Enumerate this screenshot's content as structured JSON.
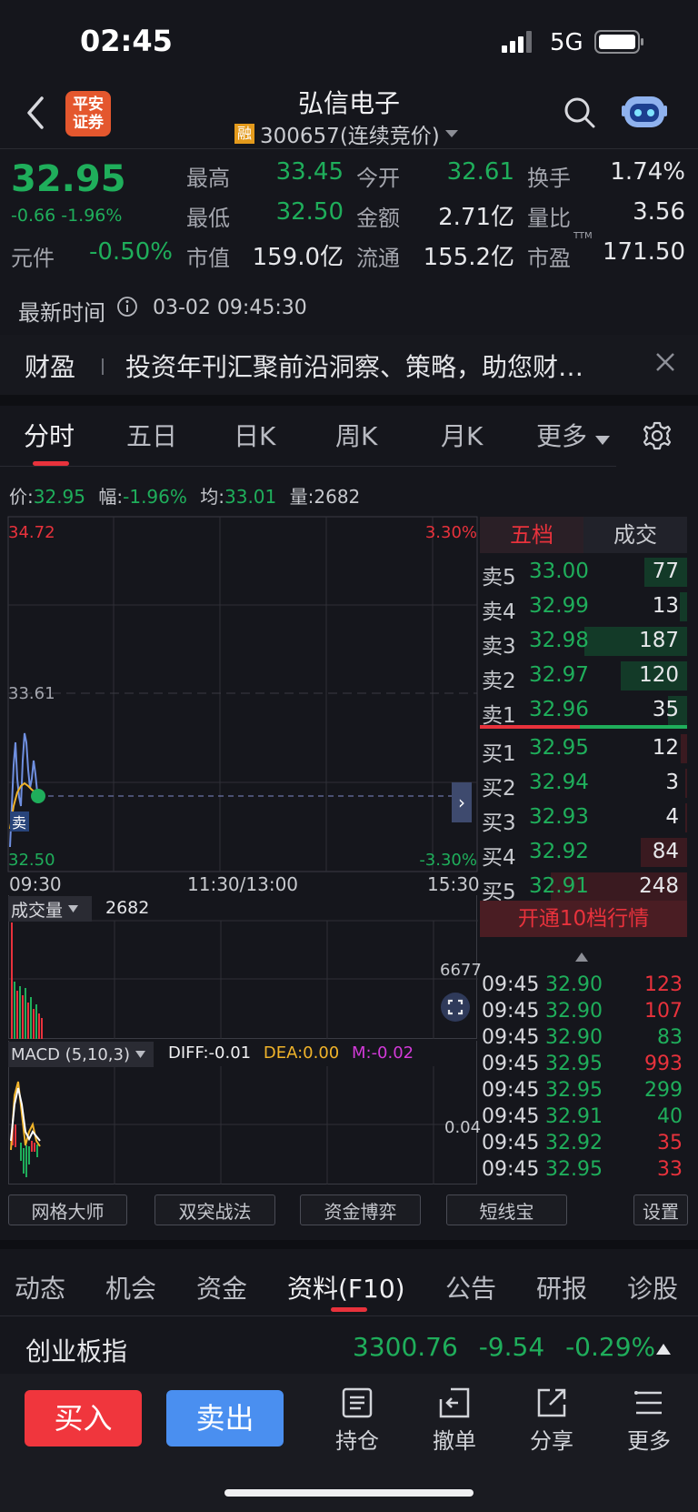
{
  "status_bar": {
    "time": "02:45",
    "network": "5G"
  },
  "header": {
    "badge_line1": "平安",
    "badge_line2": "证券",
    "title": "弘信电子",
    "margin_tag": "融",
    "code": "300657(连续竞价)"
  },
  "quote": {
    "price": "32.95",
    "change": "-0.66",
    "change_pct": "-1.96%",
    "yuanjian_label": "元件",
    "yuanjian_value": "-0.50%",
    "stats": [
      {
        "label": "最高",
        "value": "33.45",
        "color": "green"
      },
      {
        "label": "今开",
        "value": "32.61",
        "color": "green"
      },
      {
        "label": "换手",
        "value": "1.74%",
        "color": "white"
      },
      {
        "label": "最低",
        "value": "32.50",
        "color": "green"
      },
      {
        "label": "金额",
        "value": "2.71亿",
        "color": "white"
      },
      {
        "label": "量比",
        "value": "3.56",
        "color": "white"
      },
      {
        "label": "市值",
        "value": "159.0亿",
        "color": "white"
      },
      {
        "label": "流通",
        "value": "155.2亿",
        "color": "white"
      },
      {
        "label": "市盈",
        "value": "171.50",
        "color": "white"
      }
    ],
    "pe_sup": "TTM",
    "time_label": "最新时间",
    "time_value": "03-02 09:45:30"
  },
  "banner": {
    "brand": "财盈",
    "text": "投资年刊汇聚前沿洞察、策略，助您财…"
  },
  "chart_tabs": [
    "分时",
    "五日",
    "日K",
    "周K",
    "月K",
    "更多"
  ],
  "info_line": {
    "price_label": "价:",
    "price": "32.95",
    "amp_label": "幅:",
    "amp": "-1.96%",
    "avg_label": "均:",
    "avg": "33.01",
    "vol_label": "量:",
    "vol": "2682"
  },
  "chart": {
    "top_price": "34.72",
    "top_pct": "3.30%",
    "mid_price": "33.61",
    "bottom_price": "32.50",
    "bottom_pct": "-3.30%",
    "sell_marker": "卖",
    "x_start": "09:30",
    "x_mid": "11:30/13:00",
    "x_end": "15:30"
  },
  "volume": {
    "label": "成交量",
    "value": "2682",
    "max": "6677"
  },
  "macd": {
    "label": "MACD (5,10,3)",
    "diff": "DIFF:-0.01",
    "dea": "DEA:0.00",
    "m": "M:-0.02",
    "scale": "0.04"
  },
  "orderbook": {
    "tab_active": "五档",
    "tab_other": "成交",
    "asks": [
      {
        "label": "卖5",
        "price": "33.00",
        "vol": "77"
      },
      {
        "label": "卖4",
        "price": "32.99",
        "vol": "13"
      },
      {
        "label": "卖3",
        "price": "32.98",
        "vol": "187"
      },
      {
        "label": "卖2",
        "price": "32.97",
        "vol": "120"
      },
      {
        "label": "卖1",
        "price": "32.96",
        "vol": "35"
      }
    ],
    "bids": [
      {
        "label": "买1",
        "price": "32.95",
        "vol": "12"
      },
      {
        "label": "买2",
        "price": "32.94",
        "vol": "3"
      },
      {
        "label": "买3",
        "price": "32.93",
        "vol": "4"
      },
      {
        "label": "买4",
        "price": "32.92",
        "vol": "84"
      },
      {
        "label": "买5",
        "price": "32.91",
        "vol": "248"
      }
    ],
    "upgrade": "开通10档行情"
  },
  "trades": [
    {
      "time": "09:45",
      "price": "32.90",
      "vol": "123",
      "dir": "red"
    },
    {
      "time": "09:45",
      "price": "32.90",
      "vol": "107",
      "dir": "red"
    },
    {
      "time": "09:45",
      "price": "32.90",
      "vol": "83",
      "dir": "green"
    },
    {
      "time": "09:45",
      "price": "32.95",
      "vol": "993",
      "dir": "red"
    },
    {
      "time": "09:45",
      "price": "32.95",
      "vol": "299",
      "dir": "green"
    },
    {
      "time": "09:45",
      "price": "32.91",
      "vol": "40",
      "dir": "green"
    },
    {
      "time": "09:45",
      "price": "32.92",
      "vol": "35",
      "dir": "red"
    },
    {
      "time": "09:45",
      "price": "32.95",
      "vol": "33",
      "dir": "red"
    }
  ],
  "tools": [
    "网格大师",
    "双突战法",
    "资金博弈",
    "短线宝",
    "设置"
  ],
  "bottom_tabs": [
    "动态",
    "机会",
    "资金",
    "资料(F10)",
    "公告",
    "研报",
    "诊股"
  ],
  "index_bar": {
    "name": "创业板指",
    "value": "3300.76",
    "change": "-9.54",
    "pct": "-0.29%"
  },
  "toolbar": {
    "buy": "买入",
    "sell": "卖出",
    "hold": "持仓",
    "cancel": "撤单",
    "share": "分享",
    "more": "更多"
  },
  "icons": [
    "back-arrow-icon",
    "search-icon",
    "robot-icon",
    "info-icon",
    "close-icon",
    "settings-gear-icon",
    "expand-icon",
    "holding-icon",
    "cancel-order-icon",
    "share-icon",
    "menu-icon"
  ],
  "colors": {
    "green": "#1fae5b",
    "red": "#e8323c",
    "buy": "#e8323c",
    "sell": "#3b82f6",
    "bg": "#15161c"
  }
}
